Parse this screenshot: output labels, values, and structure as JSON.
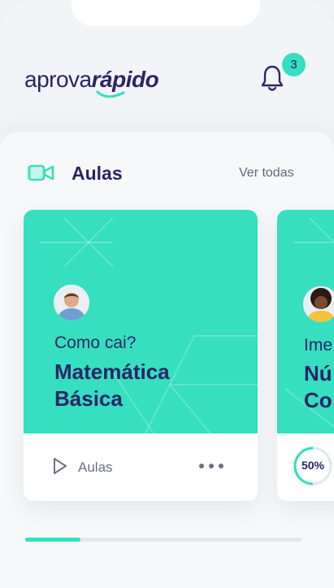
{
  "header": {
    "logo_light": "aprova",
    "logo_bold": "rápido",
    "notifications_count": "3"
  },
  "section": {
    "title": "Aulas",
    "see_all_label": "Ver todas"
  },
  "cards": [
    {
      "subtitle": "Como cai?",
      "title_line1": "Matemática",
      "title_line2": "Básica",
      "footer_label": "Aulas"
    },
    {
      "subtitle": "Ime",
      "title_line1": "Nú",
      "title_line2": "Co",
      "progress_label": "50%",
      "progress": 0.5
    }
  ],
  "carousel": {
    "progress": 0.2
  },
  "colors": {
    "accent": "#35dfc0",
    "brand": "#2a2466",
    "muted": "#6b7282"
  }
}
